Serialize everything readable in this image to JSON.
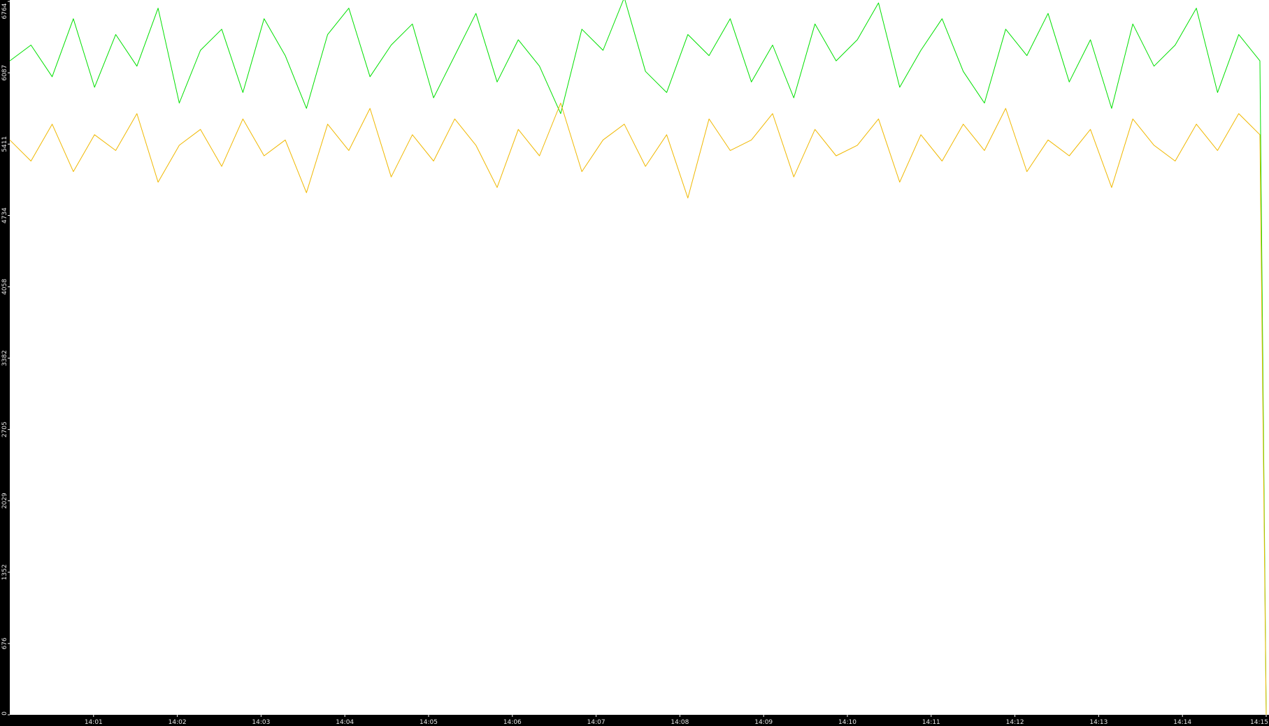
{
  "chart_data": {
    "type": "line",
    "title": "",
    "xlabel": "",
    "ylabel": "",
    "ylim": [
      0,
      6764
    ],
    "y_ticks": [
      0,
      676,
      1352,
      2029,
      2705,
      3382,
      4058,
      4734,
      5411,
      6087,
      6764
    ],
    "y_tick_labels": [
      "0",
      "676",
      "1352",
      "2029",
      "2705",
      "3382",
      "4058",
      "4734",
      "5411",
      "6087",
      "6764"
    ],
    "x_start": "14:00",
    "x_end": "14:15",
    "x_ticks": [
      "14:01",
      "14:02",
      "14:03",
      "14:04",
      "14:05",
      "14:06",
      "14:07",
      "14:08",
      "14:09",
      "14:10",
      "14:11",
      "14:12",
      "14:13",
      "14:14",
      "14:15"
    ],
    "grid": false,
    "background": "#ffffff",
    "series": [
      {
        "color": "#00e000",
        "values": [
          6200,
          6350,
          6050,
          6600,
          5950,
          6450,
          6150,
          6700,
          5800,
          6300,
          6500,
          5900,
          6600,
          6250,
          5750,
          6450,
          6700,
          6050,
          6350,
          6550,
          5850,
          6250,
          6650,
          6000,
          6400,
          6150,
          5700,
          6500,
          6300,
          6800,
          6100,
          5900,
          6450,
          6250,
          6600,
          6000,
          6350,
          5850,
          6550,
          6200,
          6400,
          6750,
          5950,
          6300,
          6600,
          6100,
          5800,
          6500,
          6250,
          6650,
          6000,
          6400,
          5750,
          6550,
          6150,
          6350,
          6700,
          5900,
          6450,
          6200
        ]
      },
      {
        "color": "#f0b800",
        "values": [
          5450,
          5250,
          5600,
          5150,
          5500,
          5350,
          5700,
          5050,
          5400,
          5550,
          5200,
          5650,
          5300,
          5450,
          4950,
          5600,
          5350,
          5750,
          5100,
          5500,
          5250,
          5650,
          5400,
          5000,
          5550,
          5300,
          5800,
          5150,
          5450,
          5600,
          5200,
          5500,
          4900,
          5650,
          5350,
          5450,
          5700,
          5100,
          5550,
          5300,
          5400,
          5650,
          5050,
          5500,
          5250,
          5600,
          5350,
          5750,
          5150,
          5450,
          5300,
          5550,
          5000,
          5650,
          5400,
          5250,
          5600,
          5350,
          5700,
          5500
        ]
      }
    ]
  }
}
